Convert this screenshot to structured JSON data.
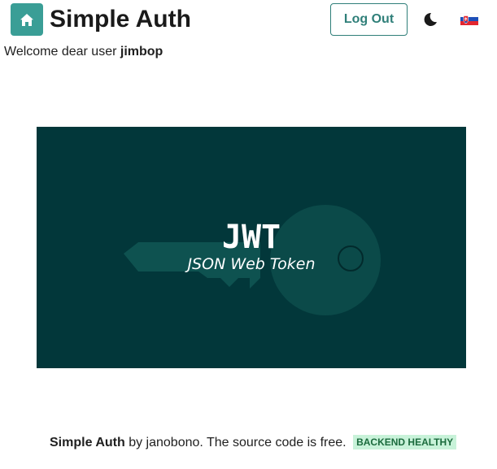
{
  "header": {
    "home_icon": "home-icon",
    "title": "Simple Auth",
    "logout_label": "Log Out",
    "theme_icon": "moon-icon",
    "language_icon": "slovak-flag-icon"
  },
  "welcome": {
    "prefix": "Welcome dear user",
    "username": "jimbop"
  },
  "banner": {
    "title": "JWT",
    "subtitle": "JSON Web Token",
    "background_color": "#02373a"
  },
  "footer": {
    "brand": "Simple Auth",
    "by_text": " by janobono. The source code is free. ",
    "status_badge": "BACKEND HEALTHY",
    "badge_color": "#c8f2d9"
  },
  "colors": {
    "accent": "#3a9e96",
    "outline": "#2f7f79"
  }
}
